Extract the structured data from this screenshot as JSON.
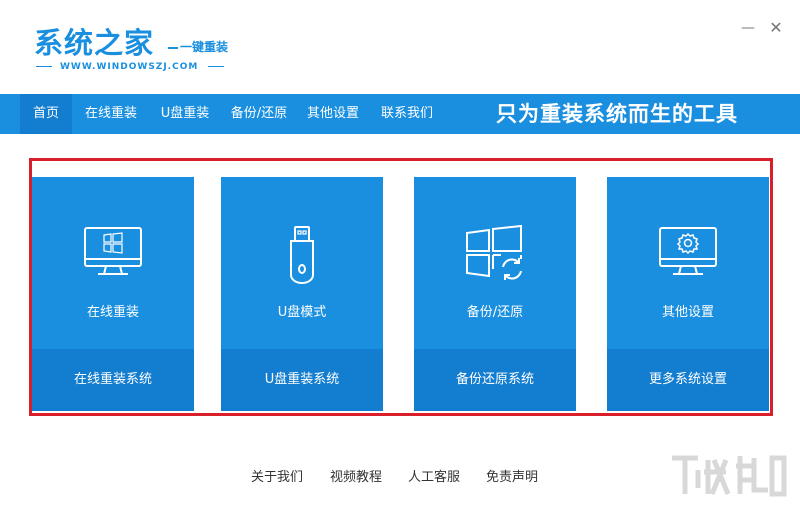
{
  "app": {
    "logo_main": "系统之家",
    "logo_sub": "一键重装",
    "logo_url": "WWW.WINDOWSZJ.COM",
    "min_glyph": "—",
    "close_glyph": "✕"
  },
  "nav": {
    "items": [
      {
        "label": "首页",
        "active": true
      },
      {
        "label": "在线重装"
      },
      {
        "label": "U盘重装"
      },
      {
        "label": "备份/还原"
      },
      {
        "label": "其他设置"
      },
      {
        "label": "联系我们"
      }
    ],
    "slogan": "只为重装系统而生的工具"
  },
  "cards": [
    {
      "title": "在线重装",
      "subtitle": "在线重装系统",
      "icon": "monitor-windows-icon"
    },
    {
      "title": "U盘模式",
      "subtitle": "U盘重装系统",
      "icon": "usb-drive-icon"
    },
    {
      "title": "备份/还原",
      "subtitle": "备份还原系统",
      "icon": "windows-restore-icon"
    },
    {
      "title": "其他设置",
      "subtitle": "更多系统设置",
      "icon": "monitor-gear-icon"
    }
  ],
  "footer": {
    "links": [
      "关于我们",
      "视频教程",
      "人工客服",
      "免责声明"
    ]
  },
  "colors": {
    "primary": "#1a8fe0",
    "primary_dark": "#137dd0",
    "highlight_frame": "#d9202a"
  }
}
